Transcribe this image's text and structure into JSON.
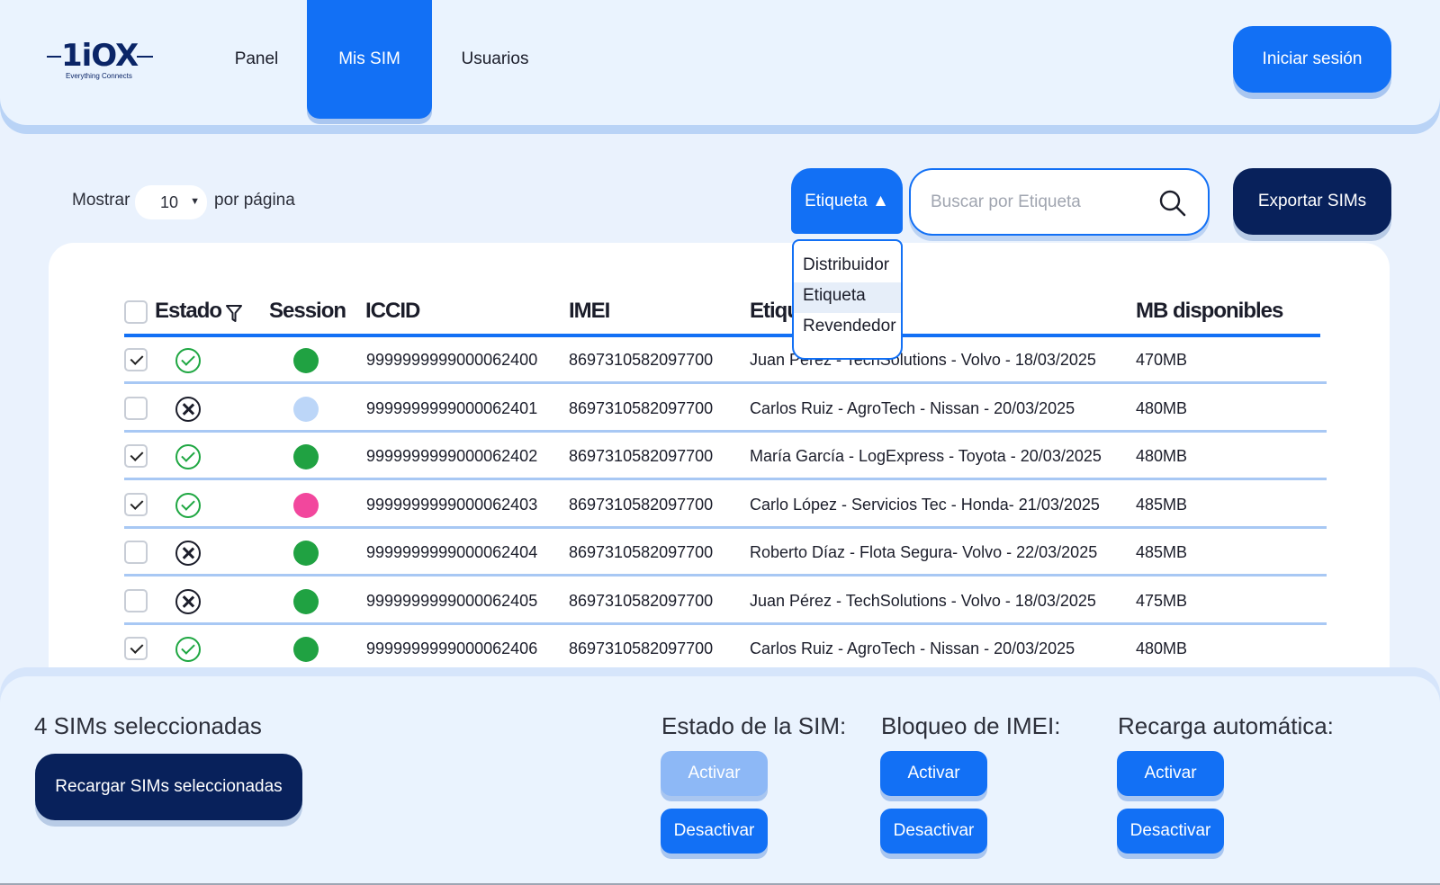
{
  "brand": {
    "logo_text": "1iOX",
    "tagline": "Everything Connects"
  },
  "nav": {
    "items": [
      {
        "label": "Panel"
      },
      {
        "label": "Mis SIM"
      },
      {
        "label": "Usuarios"
      }
    ],
    "active": "Mis SIM",
    "login_label": "Iniciar sesión"
  },
  "toolbar": {
    "show_label": "Mostrar",
    "per_page_value": "10",
    "per_page_label": "por página",
    "filter_label": "Etiqueta ▲",
    "search_placeholder": "Buscar por Etiqueta",
    "export_label": "Exportar SIMs"
  },
  "dropdown": {
    "options": [
      "Distribuidor",
      "Etiqueta",
      "Revendedor"
    ],
    "selected": "Etiqueta"
  },
  "table": {
    "headers": {
      "estado": "Estado",
      "session": "Session",
      "iccid": "ICCID",
      "imei": "IMEI",
      "etiqueta": "Etiqueta",
      "mb": "MB disponibles"
    },
    "rows": [
      {
        "checked": true,
        "status": "ok",
        "session_color": "#20a242",
        "iccid": "9999999999000062400",
        "imei": "8697310582097700",
        "tag": "Juan Pérez - TechSolutions - Volvo - 18/03/2025",
        "mb": "470MB"
      },
      {
        "checked": false,
        "status": "no",
        "session_color": "#bcd6f8",
        "iccid": "9999999999000062401",
        "imei": "8697310582097700",
        "tag": "Carlos Ruiz - AgroTech -     Nissan   - 20/03/2025",
        "mb": "480MB"
      },
      {
        "checked": true,
        "status": "ok",
        "session_color": "#20a242",
        "iccid": "9999999999000062402",
        "imei": "8697310582097700",
        "tag": "María García - LogExpress - Toyota - 20/03/2025",
        "mb": "480MB"
      },
      {
        "checked": true,
        "status": "ok",
        "session_color": "#f2479d",
        "iccid": "9999999999000062403",
        "imei": "8697310582097700",
        "tag": "Carlo López - Servicios Tec - Honda- 21/03/2025",
        "mb": "485MB"
      },
      {
        "checked": false,
        "status": "no",
        "session_color": "#20a242",
        "iccid": "9999999999000062404",
        "imei": "8697310582097700",
        "tag": "Roberto Díaz - Flota Segura- Volvo - 22/03/2025",
        "mb": "485MB"
      },
      {
        "checked": false,
        "status": "no",
        "session_color": "#20a242",
        "iccid": "9999999999000062405",
        "imei": "8697310582097700",
        "tag": "Juan Pérez - TechSolutions - Volvo - 18/03/2025",
        "mb": "475MB"
      },
      {
        "checked": true,
        "status": "ok",
        "session_color": "#20a242",
        "iccid": "9999999999000062406",
        "imei": "8697310582097700",
        "tag": "Carlos Ruiz - AgroTech -     Nissan   - 20/03/2025",
        "mb": "480MB"
      }
    ]
  },
  "bottom": {
    "selected_count": "4 SIMs seleccionadas",
    "recharge_label": "Recargar SIMs seleccionadas",
    "groups": [
      {
        "title": "Estado de la SIM:",
        "activate": "Activar",
        "deactivate": "Desactivar",
        "activate_disabled": true
      },
      {
        "title": "Bloqueo de IMEI:",
        "activate": "Activar",
        "deactivate": "Desactivar",
        "activate_disabled": false
      },
      {
        "title": "Recarga automática:",
        "activate": "Activar",
        "deactivate": "Desactivar",
        "activate_disabled": false
      }
    ]
  },
  "colors": {
    "primary": "#1270f5",
    "navy": "#08215b",
    "background": "#eaf2fd",
    "ok": "#1fa742"
  }
}
